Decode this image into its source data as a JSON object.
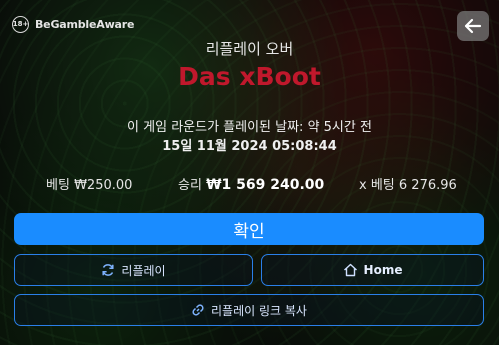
{
  "header": {
    "bga_badge": "18+",
    "bga_label": "BeGambleAware",
    "back_icon": "arrow-left-icon"
  },
  "replay": {
    "subtitle": "리플레이 오버",
    "game_title": "Das xBoot",
    "played_text": "이 게임 라운드가 플레이된 날짜: 약 5시간 전",
    "played_date": "15일 11월 2024 05:08:44"
  },
  "stats": {
    "bet_label": "베팅",
    "bet_value": "₩250.00",
    "win_label": "승리",
    "win_value": "₩1 569 240.00",
    "multiplier_label": "x 베팅",
    "multiplier_value": "6 276.96"
  },
  "buttons": {
    "confirm": "확인",
    "replay": "리플레이",
    "home": "Home",
    "copy_link": "리플레이 링크 복사"
  },
  "colors": {
    "accent": "#1a8cff",
    "title": "#c0182c",
    "outline": "#2a7fe8"
  }
}
